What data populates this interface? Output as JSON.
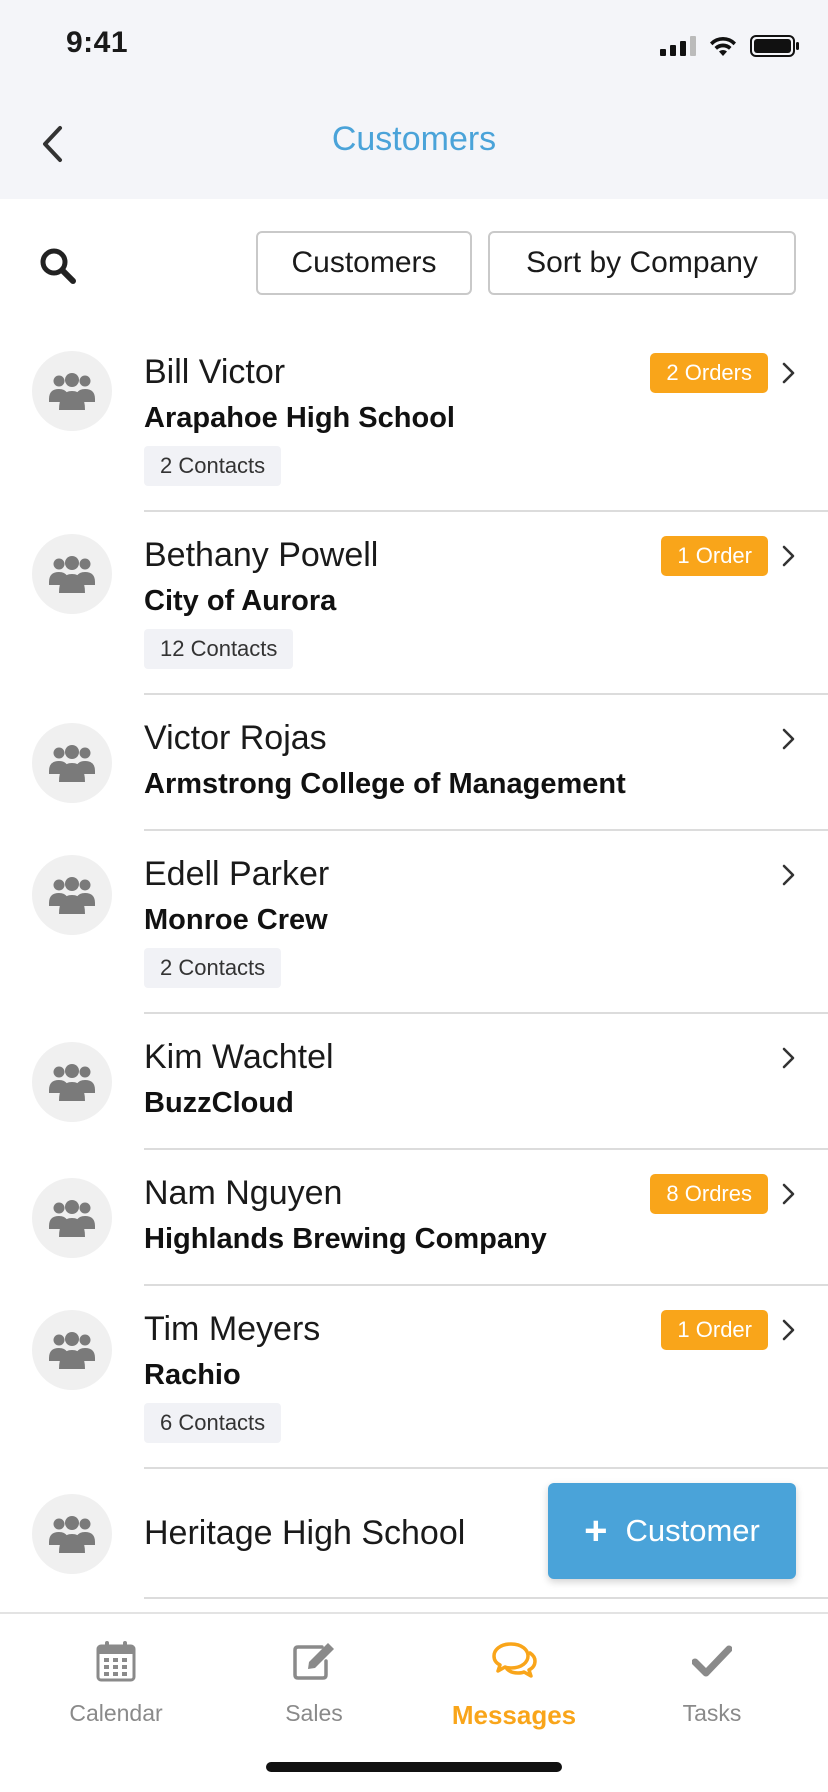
{
  "status_bar": {
    "time": "9:41"
  },
  "nav": {
    "title": "Customers"
  },
  "toolbar": {
    "filter_label": "Customers",
    "sort_label": "Sort by Company"
  },
  "customers": [
    {
      "name": "Bill Victor",
      "company": "Arapahoe High School",
      "contacts": "2 Contacts",
      "orders": "2 Orders"
    },
    {
      "name": "Bethany Powell",
      "company": "City of Aurora",
      "contacts": "12 Contacts",
      "orders": "1 Order"
    },
    {
      "name": "Victor Rojas",
      "company": "Armstrong College of Management",
      "contacts": "",
      "orders": ""
    },
    {
      "name": "Edell Parker",
      "company": "Monroe Crew",
      "contacts": "2 Contacts",
      "orders": ""
    },
    {
      "name": "Kim Wachtel",
      "company": "BuzzCloud",
      "contacts": "",
      "orders": ""
    },
    {
      "name": "Nam Nguyen",
      "company": "Highlands Brewing Company",
      "contacts": "",
      "orders": "8 Ordres"
    },
    {
      "name": "Tim Meyers",
      "company": "Rachio",
      "contacts": "6 Contacts",
      "orders": "1 Order"
    },
    {
      "name": "Heritage High School",
      "company": "",
      "contacts": "",
      "orders": ""
    }
  ],
  "fab": {
    "label": "Customer",
    "icon": "plus-icon"
  },
  "tabbar": {
    "tabs": [
      {
        "label": "Calendar",
        "icon": "calendar-icon",
        "active": false
      },
      {
        "label": "Sales",
        "icon": "edit-icon",
        "active": false
      },
      {
        "label": "Messages",
        "icon": "chat-bubbles-icon",
        "active": true
      },
      {
        "label": "Tasks",
        "icon": "checkmark-icon",
        "active": false
      }
    ]
  },
  "colors": {
    "accent_blue": "#4aa3d9",
    "accent_orange": "#f9a51a",
    "header_bg": "#f4f5f9",
    "icon_gray": "#8a8a8a"
  }
}
